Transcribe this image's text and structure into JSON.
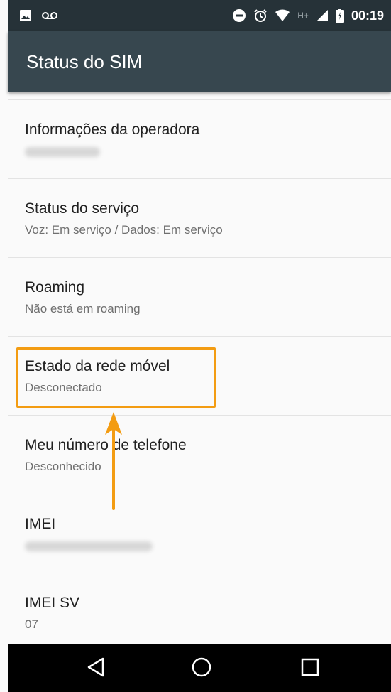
{
  "status_bar": {
    "time": "00:19",
    "network_label": "H+",
    "icons": [
      "image-icon",
      "voicemail-icon",
      "dnd-icon",
      "alarm-icon",
      "wifi-icon",
      "signal-icon",
      "battery-icon"
    ]
  },
  "app_bar": {
    "title": "Status do SIM"
  },
  "items": [
    {
      "title": "Informações da operadora",
      "subtitle": ""
    },
    {
      "title": "Status do serviço",
      "subtitle": "Voz: Em serviço / Dados: Em serviço"
    },
    {
      "title": "Roaming",
      "subtitle": "Não está em roaming"
    },
    {
      "title": "Estado da rede móvel",
      "subtitle": "Desconectado"
    },
    {
      "title": "Meu número de telefone",
      "subtitle": "Desconhecido"
    },
    {
      "title": "IMEI",
      "subtitle": ""
    },
    {
      "title": "IMEI SV",
      "subtitle": "07"
    }
  ],
  "highlight_color": "#f39c12",
  "nav_bar": {
    "buttons": [
      "back-icon",
      "home-icon",
      "recents-icon"
    ]
  }
}
